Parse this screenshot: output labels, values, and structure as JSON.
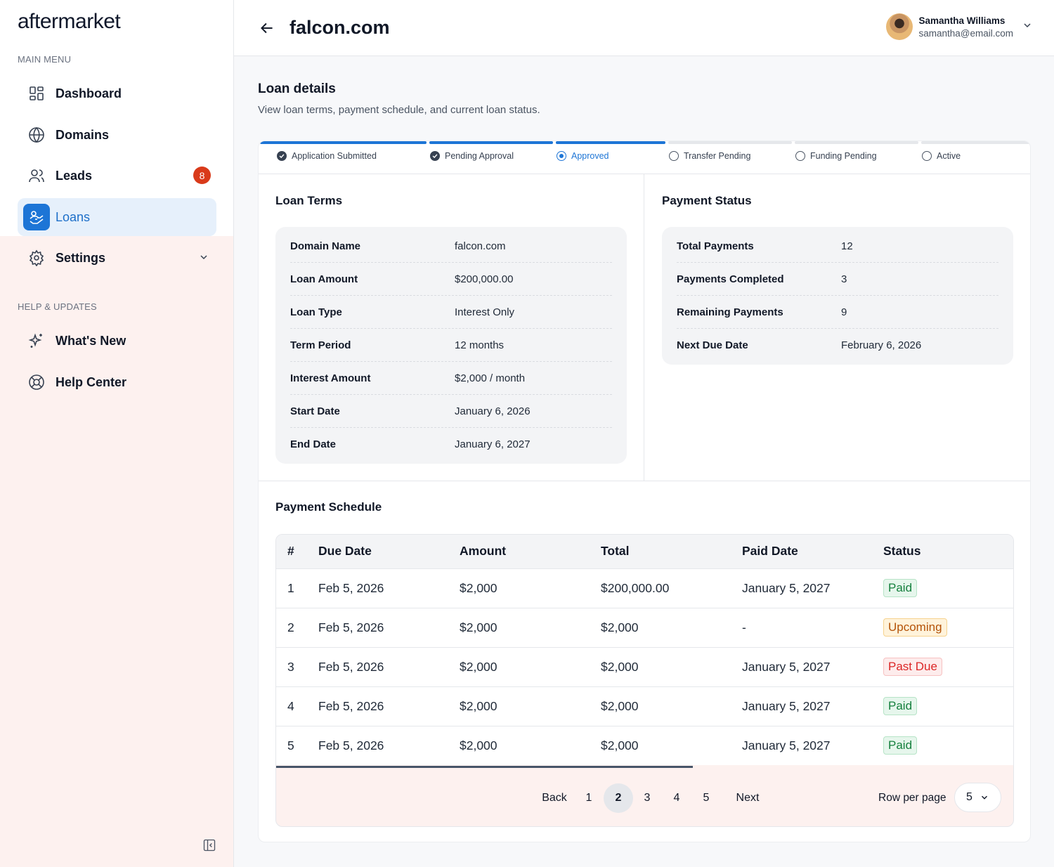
{
  "sidebar": {
    "logo": "aftermarket",
    "main_menu_label": "MAIN MENU",
    "help_label": "HELP & UPDATES",
    "items": [
      {
        "label": "Dashboard",
        "icon": "dashboard-icon"
      },
      {
        "label": "Domains",
        "icon": "globe-icon"
      },
      {
        "label": "Leads",
        "icon": "users-icon",
        "badge": "8"
      },
      {
        "label": "Loans",
        "icon": "loan-handshake-icon",
        "active": true
      },
      {
        "label": "Settings",
        "icon": "gear-icon"
      }
    ],
    "help_items": [
      {
        "label": "What's New",
        "icon": "sparkle-icon"
      },
      {
        "label": "Help Center",
        "icon": "lifebuoy-icon"
      }
    ]
  },
  "header": {
    "title": "falcon.com",
    "user": {
      "name": "Samantha Williams",
      "email": "samantha@email.com"
    }
  },
  "main": {
    "title": "Loan details",
    "subtitle": "View loan terms, payment schedule, and current loan status."
  },
  "steps": [
    {
      "label": "Application Submitted",
      "state": "done"
    },
    {
      "label": "Pending Approval",
      "state": "done"
    },
    {
      "label": "Approved",
      "state": "current"
    },
    {
      "label": "Transfer Pending",
      "state": "todo"
    },
    {
      "label": "Funding Pending",
      "state": "todo"
    },
    {
      "label": "Active",
      "state": "todo"
    }
  ],
  "loan_terms": {
    "title": "Loan Terms",
    "rows": [
      {
        "k": "Domain Name",
        "v": "falcon.com"
      },
      {
        "k": "Loan Amount",
        "v": "$200,000.00"
      },
      {
        "k": "Loan Type",
        "v": "Interest Only"
      },
      {
        "k": "Term Period",
        "v": "12 months"
      },
      {
        "k": "Interest Amount",
        "v": "$2,000 / month"
      },
      {
        "k": "Start Date",
        "v": "January 6, 2026"
      },
      {
        "k": "End Date",
        "v": "January 6, 2027"
      }
    ]
  },
  "payment_status": {
    "title": "Payment Status",
    "rows": [
      {
        "k": "Total Payments",
        "v": "12"
      },
      {
        "k": "Payments Completed",
        "v": "3"
      },
      {
        "k": "Remaining Payments",
        "v": "9"
      },
      {
        "k": "Next Due Date",
        "v": "February 6, 2026"
      }
    ]
  },
  "schedule": {
    "title": "Payment Schedule",
    "columns": [
      "#",
      "Due Date",
      "Amount",
      "Total",
      "Paid Date",
      "Status"
    ],
    "rows": [
      {
        "n": "1",
        "due": "Feb 5, 2026",
        "amount": "$2,000",
        "total": "$200,000.00",
        "paid": "January 5, 2027",
        "status": "Paid"
      },
      {
        "n": "2",
        "due": "Feb 5, 2026",
        "amount": "$2,000",
        "total": "$2,000",
        "paid": "-",
        "status": "Upcoming"
      },
      {
        "n": "3",
        "due": "Feb 5, 2026",
        "amount": "$2,000",
        "total": "$2,000",
        "paid": "January 5, 2027",
        "status": "Past Due"
      },
      {
        "n": "4",
        "due": "Feb 5, 2026",
        "amount": "$2,000",
        "total": "$2,000",
        "paid": "January 5, 2027",
        "status": "Paid"
      },
      {
        "n": "5",
        "due": "Feb 5, 2026",
        "amount": "$2,000",
        "total": "$2,000",
        "paid": "January 5, 2027",
        "status": "Paid"
      }
    ],
    "pager": {
      "back": "Back",
      "pages": [
        "1",
        "2",
        "3",
        "4",
        "5"
      ],
      "current": "2",
      "next": "Next",
      "rows_label": "Row per page",
      "rows_value": "5"
    }
  },
  "colors": {
    "accent": "#1d75d6",
    "badge": "#d93a1a",
    "sidebar_bg": "#fdf1ef"
  }
}
